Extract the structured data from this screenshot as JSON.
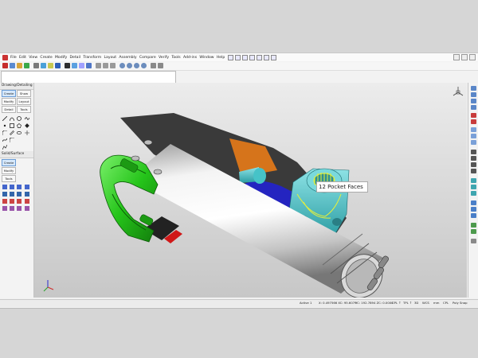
{
  "menubar": {
    "items": [
      "File",
      "Edit",
      "View",
      "Create",
      "Modify",
      "Detail",
      "Transform",
      "Layout",
      "Assembly",
      "Compare",
      "Verify",
      "Tools",
      "Add-ins",
      "Window",
      "Help"
    ]
  },
  "left_panel": {
    "drawing_title": "Drawing/Detailing",
    "drawing_buttons": [
      "Create",
      "Show",
      "Modify",
      "Layout",
      "Detail",
      "Tools"
    ],
    "solid_title": "Solid/Surface",
    "solid_buttons": [
      "Create",
      "Modify",
      "Tools"
    ]
  },
  "viewport": {
    "tag_label": "12 Pocket Faces"
  },
  "status": {
    "active": "Active 1",
    "coords": "X: 0.497566 XC: 95.6079",
    "yc": "YC: 192.7894 ZC: 0.0000",
    "cplane": "CPL ↑",
    "tplane": "TPL ↑",
    "view": "3D",
    "wcs": "WCS",
    "mm": "mm",
    "cpl": "CPL",
    "poly": "Poly Snap"
  },
  "colors": {
    "green_part": "#25c41a",
    "cyan_part": "#46c3c8",
    "blue_part": "#2424c0",
    "orange_part": "#d6741b",
    "cylinder": "#e8e8e8",
    "highlight": "#e8f038"
  }
}
